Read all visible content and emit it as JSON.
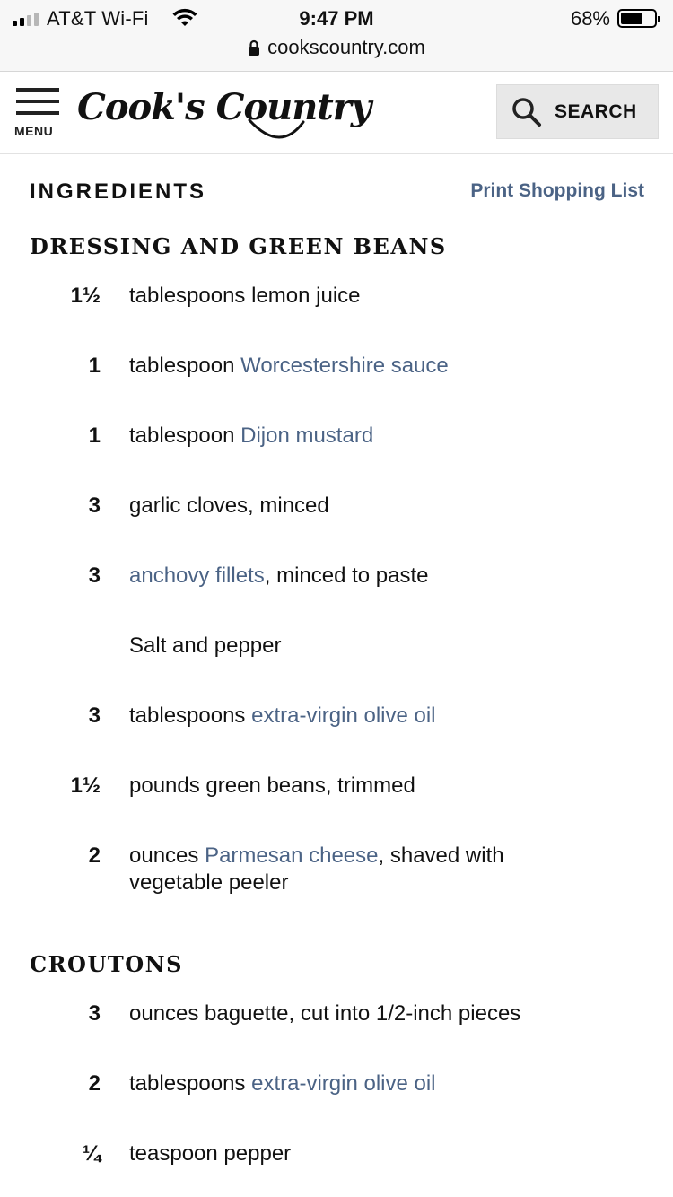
{
  "status_bar": {
    "carrier": "AT&T Wi-Fi",
    "time": "9:47 PM",
    "battery": "68%",
    "battery_level": 0.68
  },
  "browser": {
    "url": "cookscountry.com"
  },
  "header": {
    "menu_label": "MENU",
    "logo": "Cook's Country",
    "search_label": "SEARCH"
  },
  "ingredients": {
    "title": "INGREDIENTS",
    "print_link": "Print Shopping List",
    "sections": [
      {
        "title": "DRESSING AND GREEN BEANS",
        "items": [
          {
            "qty": "1½",
            "unit": "tablespoons ",
            "link": "",
            "rest": "lemon juice"
          },
          {
            "qty": "1",
            "unit": "tablespoon ",
            "link": "Worcestershire sauce",
            "rest": ""
          },
          {
            "qty": "1",
            "unit": "tablespoon ",
            "link": "Dijon mustard",
            "rest": ""
          },
          {
            "qty": "3",
            "unit": "",
            "link": "",
            "rest": "garlic cloves, minced"
          },
          {
            "qty": "3",
            "unit": "",
            "link": "anchovy fillets",
            "rest": ", minced to paste"
          },
          {
            "qty": "",
            "unit": "",
            "link": "",
            "rest": "Salt and pepper"
          },
          {
            "qty": "3",
            "unit": "tablespoons ",
            "link": "extra-virgin olive oil",
            "rest": ""
          },
          {
            "qty": "1½",
            "unit": "",
            "link": "",
            "rest": "pounds green beans, trimmed"
          },
          {
            "qty": "2",
            "unit": "ounces ",
            "link": "Parmesan cheese",
            "rest": ", shaved with vegetable peeler"
          }
        ]
      },
      {
        "title": "CROUTONS",
        "items": [
          {
            "qty": "3",
            "unit": "",
            "link": "",
            "rest": "ounces baguette, cut into 1/2-inch pieces"
          },
          {
            "qty": "2",
            "unit": "tablespoons ",
            "link": "extra-virgin olive oil",
            "rest": ""
          },
          {
            "qty": "¼",
            "unit": "",
            "link": "",
            "rest": "teaspoon pepper"
          }
        ]
      }
    ]
  }
}
